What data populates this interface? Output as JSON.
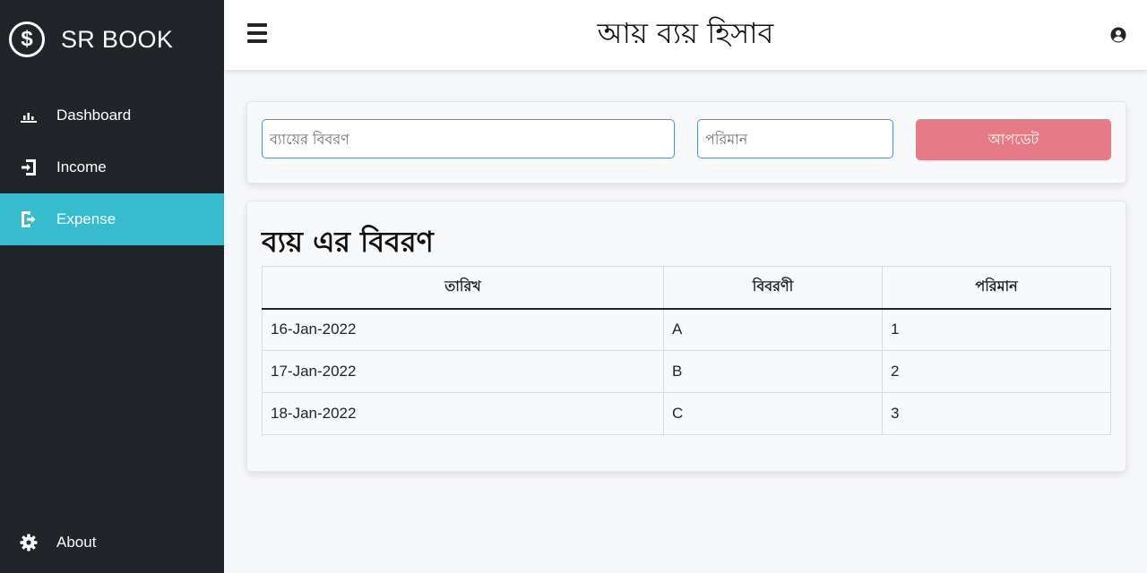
{
  "brand": {
    "logo_symbol": "$",
    "name": "SR BOOK"
  },
  "sidebar": {
    "items": [
      {
        "label": "Dashboard",
        "icon": "bar-chart-icon",
        "active": false
      },
      {
        "label": "Income",
        "icon": "sign-in-icon",
        "active": false
      },
      {
        "label": "Expense",
        "icon": "sign-out-icon",
        "active": true
      }
    ],
    "about": {
      "label": "About",
      "icon": "gear-icon"
    }
  },
  "header": {
    "title": "আয় ব্যয় হিসাব",
    "menu_icon": "hamburger-icon",
    "user_icon": "user-circle-icon"
  },
  "form": {
    "description_placeholder": "ব্যায়ের বিবরণ",
    "amount_placeholder": "পরিমান",
    "update_label": "আপডেট"
  },
  "table": {
    "title": "ব্যয় এর বিবরণ",
    "headers": [
      "তারিখ",
      "বিবরণী",
      "পরিমান"
    ],
    "rows": [
      [
        "16-Jan-2022",
        "A",
        "1"
      ],
      [
        "17-Jan-2022",
        "B",
        "2"
      ],
      [
        "18-Jan-2022",
        "C",
        "3"
      ]
    ]
  },
  "colors": {
    "sidebar_bg": "#212529",
    "active_item": "#36bccc",
    "update_button": "#e67b86",
    "input_border": "#5a8ad8"
  }
}
